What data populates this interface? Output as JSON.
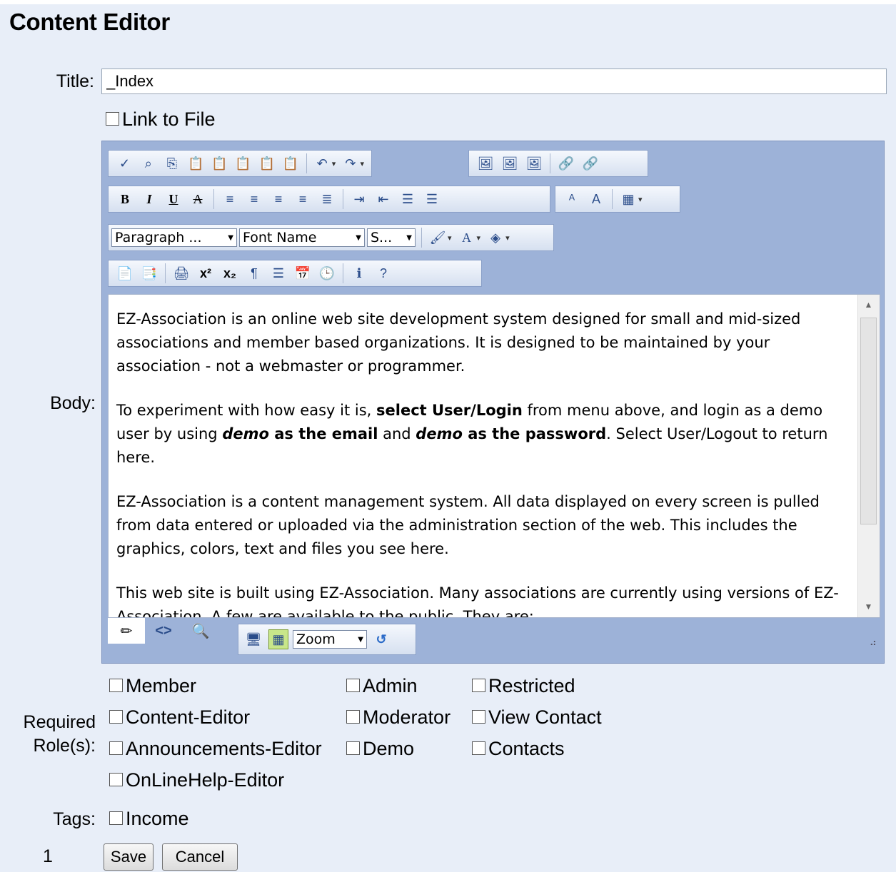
{
  "heading": "Content Editor",
  "title_label": "Title:",
  "title_value": "_Index",
  "link_to_file_label": "Link to File",
  "body_label": "Body:",
  "toolbar": {
    "paragraph_select": "Paragraph ...",
    "font_select": "Font Name",
    "size_select": "S..."
  },
  "body_paragraphs": [
    {
      "segments": [
        {
          "t": "EZ-Association is an online web site development system designed for small and mid-sized associations and member based organizations. It is designed to be maintained by your association - not a webmaster or programmer."
        }
      ]
    },
    {
      "segments": [
        {
          "t": "To experiment with how easy it is, "
        },
        {
          "t": "select User/Login",
          "b": true
        },
        {
          "t": " from menu above, and login as a demo user by using "
        },
        {
          "t": "demo",
          "b": true,
          "i": true
        },
        {
          "t": " as the email",
          "b": true
        },
        {
          "t": " and "
        },
        {
          "t": "demo",
          "b": true,
          "i": true
        },
        {
          "t": " as the password",
          "b": true
        },
        {
          "t": ". Select User/Logout to return here."
        }
      ]
    },
    {
      "segments": [
        {
          "t": "EZ-Association is a content management system. All data displayed on every screen is pulled from data entered or uploaded via the administration section of the web. This includes the graphics, colors, text and files you see here."
        }
      ]
    },
    {
      "segments": [
        {
          "t": "This web site is built using EZ-Association. Many associations are currently using versions of EZ-Association. A few are available to the public. They are:"
        }
      ]
    }
  ],
  "zoom_select": "Zoom",
  "roles_label_line1": "Required",
  "roles_label_line2": "Role(s):",
  "roles": {
    "col1": [
      "Member",
      "Content-Editor",
      "Announcements-Editor",
      "OnLineHelp-Editor"
    ],
    "col2": [
      "Admin",
      "Moderator",
      "Demo"
    ],
    "col3": [
      "Restricted",
      "View Contact",
      "Contacts"
    ]
  },
  "tags_label": "Tags:",
  "tags": [
    "Income"
  ],
  "footer_number": "1",
  "save_button": "Save",
  "cancel_button": "Cancel"
}
